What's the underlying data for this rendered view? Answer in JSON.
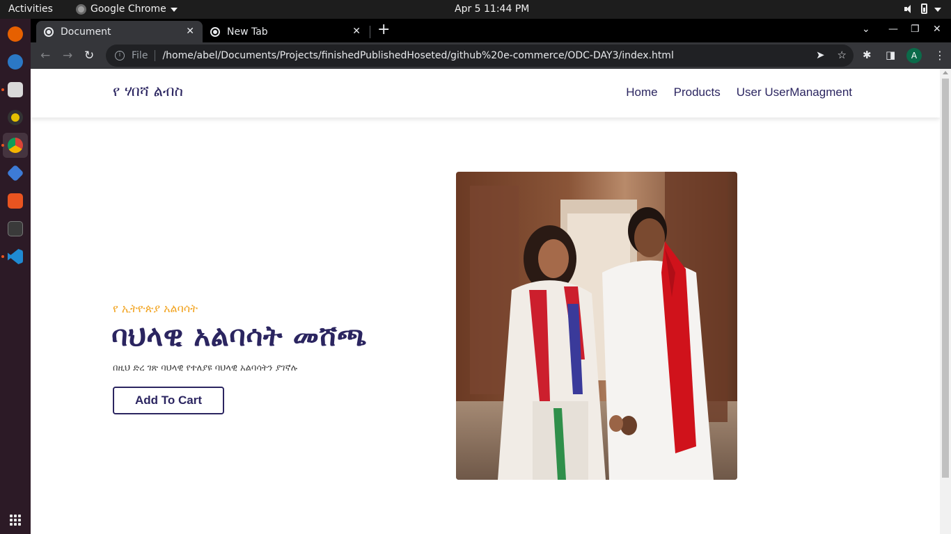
{
  "os": {
    "activities": "Activities",
    "app_name": "Google Chrome",
    "clock": "Apr 5  11:44 PM"
  },
  "dock": {
    "apps": [
      {
        "icon": "firefox-icon",
        "color": "#e66000"
      },
      {
        "icon": "thunderbird-icon",
        "color": "#2b78c5"
      },
      {
        "icon": "files-icon",
        "color": "#d9d9d9"
      },
      {
        "icon": "rhythmbox-icon",
        "color": "#e5c100"
      },
      {
        "icon": "chrome-icon",
        "color": "#4caf50"
      },
      {
        "icon": "virtualbox-icon",
        "color": "#3d7bd6"
      },
      {
        "icon": "software-center-icon",
        "color": "#e95420"
      },
      {
        "icon": "terminal-icon",
        "color": "#3a3a3a"
      },
      {
        "icon": "vscode-icon",
        "color": "#1f8ad2"
      }
    ]
  },
  "browser": {
    "tabs": [
      {
        "title": "Document",
        "active": true
      },
      {
        "title": "New Tab",
        "active": false
      }
    ],
    "scheme_label": "File",
    "url": "/home/abel/Documents/Projects/finishedPublishedHoseted/github%20e-commerce/ODC-DAY3/index.html",
    "profile_initial": "A"
  },
  "site": {
    "brand": "የ ሃበሻ ልብስ",
    "nav": [
      "Home",
      "Products",
      "User UserManagment"
    ],
    "hero": {
      "subtitle": "የ ኢትዮጵያ አልባሳት",
      "title": "ባህላዊ አልባሳት መሸጫ",
      "description": "በዚህ ድረ ገጽ ባህላዊ የተለያዩ ባህላዊ አልባሳትን ያገኛሉ",
      "cta": "Add To Cart"
    },
    "colors": {
      "primary": "#2b2560",
      "accent": "#f2a524"
    }
  }
}
